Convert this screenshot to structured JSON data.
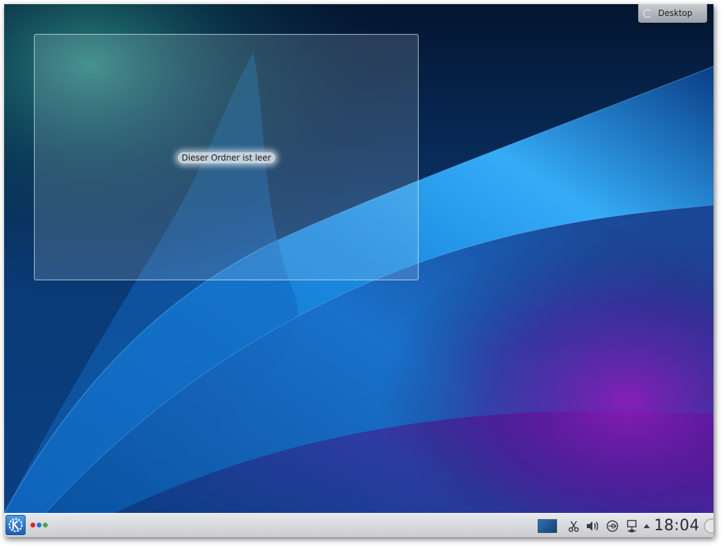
{
  "desktop": {
    "toolbox_label": "Desktop",
    "folderview": {
      "empty_message": "Dieser Ordner ist leer"
    }
  },
  "panel": {
    "kickoff_icon": "kde-logo-icon",
    "activity_dots": [
      "#d8272d",
      "#2e6cd1",
      "#4aa83a"
    ],
    "tray": {
      "pager_icon": "virtual-desktop-pager-icon",
      "clipboard_icon": "scissors-icon",
      "volume_icon": "speaker-volume-icon",
      "device_icon": "usb-device-notifier-icon",
      "network_icon": "network-icon",
      "expander_icon": "up-arrow-icon"
    },
    "clock": "18:04"
  },
  "colors": {
    "wallpaper_dark": "#04152f",
    "wallpaper_blue": "#1a7fd6",
    "wallpaper_purple": "#7a1aa8",
    "panel": "#d8dadd"
  }
}
